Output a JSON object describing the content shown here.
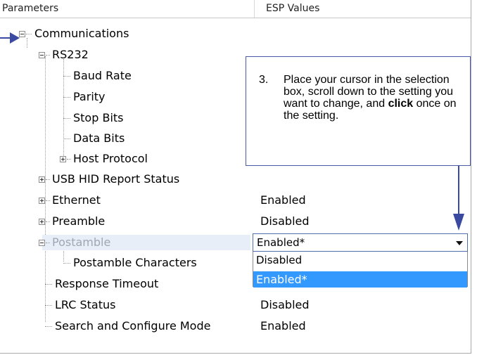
{
  "header": {
    "col_parameters": "Parameters",
    "col_values": "ESP Values"
  },
  "tree": [
    {
      "label": "Communications",
      "value": "",
      "toggle": "minus"
    },
    {
      "label": "RS232",
      "value": "",
      "toggle": "minus"
    },
    {
      "label": "Baud Rate",
      "value": "",
      "toggle": "none"
    },
    {
      "label": "Parity",
      "value": "",
      "toggle": "none"
    },
    {
      "label": "Stop Bits",
      "value": "",
      "toggle": "none"
    },
    {
      "label": "Data Bits",
      "value": "",
      "toggle": "none"
    },
    {
      "label": "Host Protocol",
      "value": "",
      "toggle": "plus"
    },
    {
      "label": "USB HID Report Status",
      "value": "",
      "toggle": "plus"
    },
    {
      "label": "Ethernet",
      "value": "Enabled",
      "toggle": "plus"
    },
    {
      "label": "Preamble",
      "value": "Disabled",
      "toggle": "plus"
    },
    {
      "label": "Postamble",
      "value": "",
      "toggle": "minus"
    },
    {
      "label": "Postamble Characters",
      "value": "",
      "toggle": "none"
    },
    {
      "label": "Response Timeout",
      "value": "",
      "toggle": "none"
    },
    {
      "label": "LRC Status",
      "value": "Disabled",
      "toggle": "none"
    },
    {
      "label": "Search and Configure Mode",
      "value": "Enabled",
      "toggle": "none"
    }
  ],
  "combo": {
    "selected": "Enabled*",
    "options": [
      "Disabled",
      "Enabled*"
    ],
    "highlighted_index": 1
  },
  "callout": {
    "number": "3.",
    "text_before": "Place your cursor in the selection box, scroll down to the setting you want to change, and ",
    "text_bold": "click",
    "text_after": " once on the setting."
  },
  "colors": {
    "accent_blue": "#3399ff",
    "callout_border": "#4a5aa8",
    "pointer_arrow": "#3a4aa0",
    "selected_row_bg": "#e8eef7",
    "disabled_label": "#a0a6b4"
  }
}
